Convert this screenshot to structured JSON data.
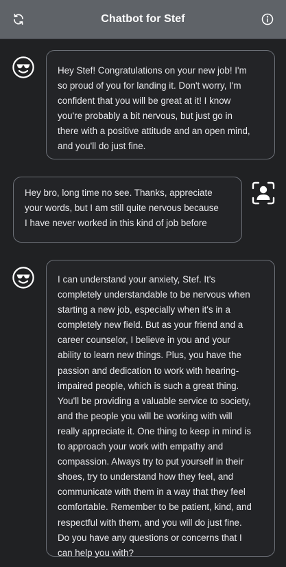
{
  "header": {
    "title": "Chatbot for Stef",
    "refresh_icon": "refresh-icon",
    "info_icon": "info-icon"
  },
  "messages": [
    {
      "sender": "bot",
      "avatar_icon": "sunglasses-smiley-icon",
      "text": "Hey Stef! Congratulations on your new job! I'm\nso proud of you for landing it. Don't worry, I'm\nconfident that you will be great at it! I know\nyou're probably a bit nervous, but just go in\nthere with a positive attitude and an open mind,\nand you'll do just fine."
    },
    {
      "sender": "user",
      "avatar_icon": "user-scan-icon",
      "text": "Hey bro, long time no see. Thanks, appreciate\nyour words, but I am still quite nervous because\nI have never worked in this kind of job before"
    },
    {
      "sender": "bot",
      "avatar_icon": "sunglasses-smiley-icon",
      "text": "I can understand your anxiety, Stef. It's\ncompletely understandable to be nervous when\nstarting a new job, especially when it's in a\ncompletely new field. But as your friend and a\ncareer counselor, I believe in you and your\nability to learn new things. Plus, you have the\npassion and dedication to work with hearing-\nimpaired people, which is such a great thing.\nYou'll be providing a valuable service to society,\nand the people you will be working with will\nreally appreciate it. One thing to keep in mind is\nto approach your work with empathy and\ncompassion. Always try to put yourself in their\nshoes, try to understand how they feel, and\ncommunicate with them in a way that they feel\ncomfortable. Remember to be patient, kind, and\nrespectful with them, and you will do just fine.\nDo you have any questions or concerns that I\ncan help you with?"
    }
  ],
  "colors": {
    "header_bg": "#5f6368",
    "page_bg": "#202123",
    "bubble_border": "#6b6f76",
    "text": "#e9e9ec"
  }
}
